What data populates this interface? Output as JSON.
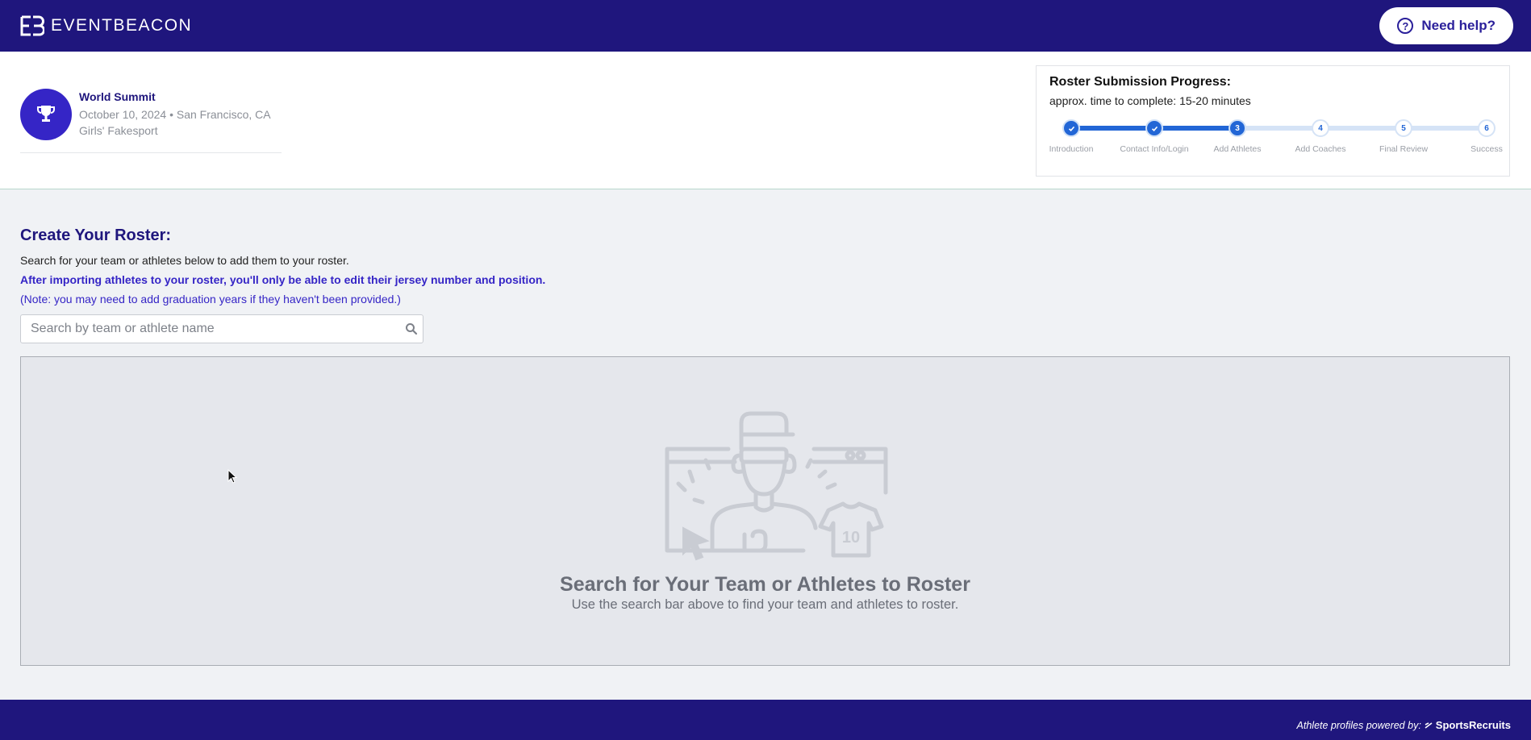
{
  "header": {
    "brand": "EVENTBEACON",
    "help_label": "Need help?"
  },
  "event": {
    "name": "World Summit",
    "date_location": "October 10, 2024 • San Francisco, CA",
    "sport": "Girls' Fakesport"
  },
  "progress": {
    "title": "Roster Submission Progress:",
    "subtitle": "approx. time to complete: 15-20 minutes",
    "current_step": 3,
    "steps": [
      {
        "number": "1",
        "label": "Introduction",
        "status": "done"
      },
      {
        "number": "2",
        "label": "Contact Info/Login",
        "status": "done"
      },
      {
        "number": "3",
        "label": "Add Athletes",
        "status": "current"
      },
      {
        "number": "4",
        "label": "Add Coaches",
        "status": "todo"
      },
      {
        "number": "5",
        "label": "Final Review",
        "status": "todo"
      },
      {
        "number": "6",
        "label": "Success",
        "status": "todo"
      }
    ]
  },
  "roster": {
    "title": "Create Your Roster:",
    "desc": "Search for your team or athletes below to add them to your roster.",
    "desc_bold": "After importing athletes to your roster, you'll only be able to edit their jersey number and position.",
    "note": "(Note: you may need to add graduation years if they haven't been provided.)",
    "search_placeholder": "Search by team or athlete name",
    "empty_title": "Search for Your Team or Athletes to Roster",
    "empty_sub": "Use the search bar above to find your team and athletes to roster.",
    "illustration_jersey_number": "10"
  },
  "footer": {
    "powered_by": "Athlete profiles powered by:",
    "partner": "SportsRecruits"
  },
  "colors": {
    "brand": "#1f167d",
    "accent": "#3525c6",
    "progress": "#2266d6"
  },
  "icons": [
    "eventbeacon-logo-icon",
    "help-icon",
    "trophy-icon",
    "checkmark-icon",
    "search-icon",
    "cursor-icon"
  ]
}
